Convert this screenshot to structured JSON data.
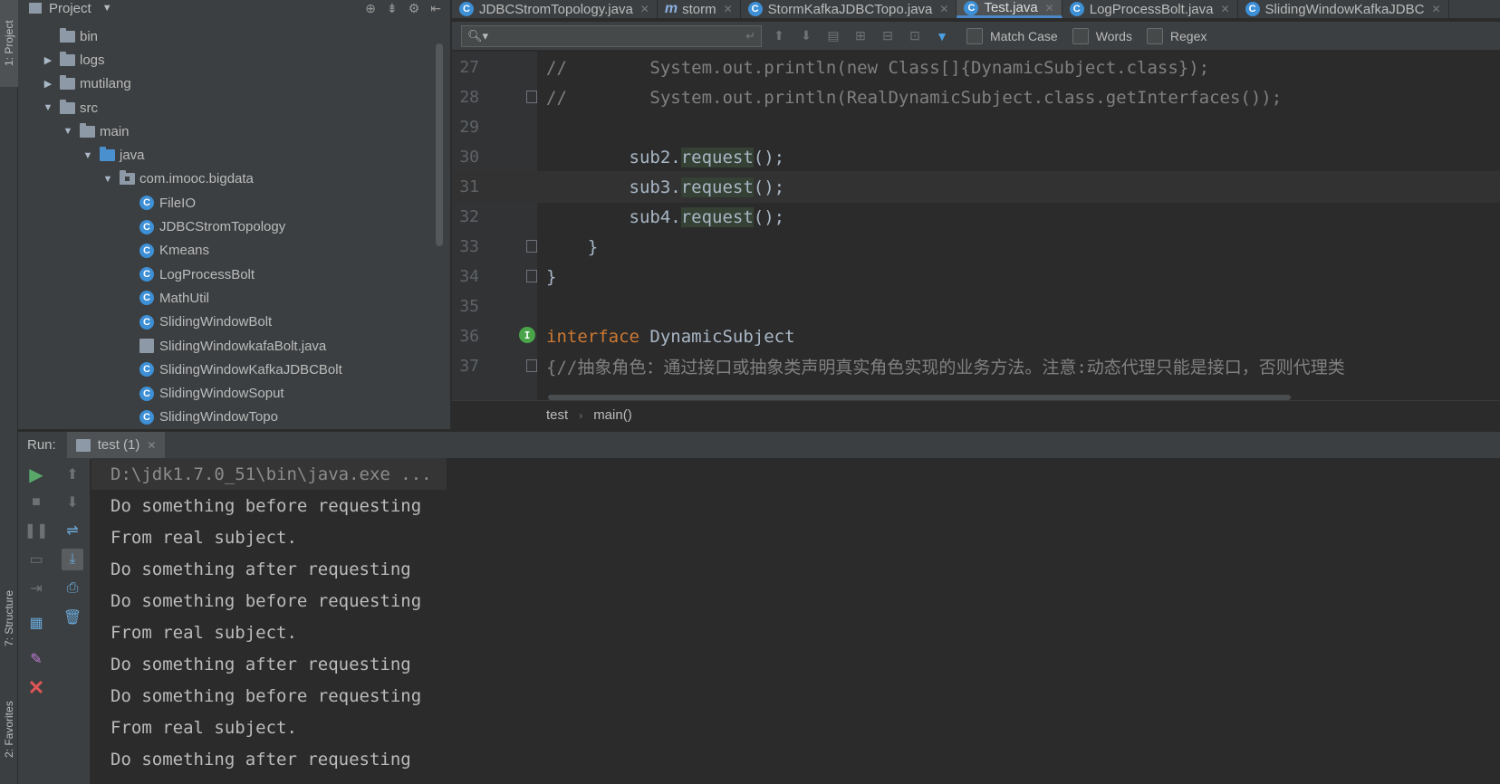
{
  "left_strip": {
    "project_tab": "1: Project",
    "structure_tab": "7: Structure",
    "favorites_tab": "2: Favorites"
  },
  "project_panel": {
    "title": "Project",
    "tree": [
      {
        "label": "bin",
        "type": "folder",
        "level": 1,
        "arrow": ""
      },
      {
        "label": "logs",
        "type": "folder",
        "level": 1,
        "arrow": "▶"
      },
      {
        "label": "mutilang",
        "type": "folder",
        "level": 1,
        "arrow": "▶"
      },
      {
        "label": "src",
        "type": "folder",
        "level": 1,
        "arrow": "▼"
      },
      {
        "label": "main",
        "type": "folder",
        "level": 2,
        "arrow": "▼"
      },
      {
        "label": "java",
        "type": "src-folder",
        "level": 3,
        "arrow": "▼"
      },
      {
        "label": "com.imooc.bigdata",
        "type": "package",
        "level": 4,
        "arrow": "▼"
      },
      {
        "label": "FileIO",
        "type": "class",
        "level": 5,
        "arrow": ""
      },
      {
        "label": "JDBCStromTopology",
        "type": "class",
        "level": 5,
        "arrow": ""
      },
      {
        "label": "Kmeans",
        "type": "class",
        "level": 5,
        "arrow": ""
      },
      {
        "label": "LogProcessBolt",
        "type": "class",
        "level": 5,
        "arrow": ""
      },
      {
        "label": "MathUtil",
        "type": "class",
        "level": 5,
        "arrow": ""
      },
      {
        "label": "SlidingWindowBolt",
        "type": "class",
        "level": 5,
        "arrow": ""
      },
      {
        "label": "SlidingWindowkafaBolt.java",
        "type": "file",
        "level": 5,
        "arrow": ""
      },
      {
        "label": "SlidingWindowKafkaJDBCBolt",
        "type": "class",
        "level": 5,
        "arrow": ""
      },
      {
        "label": "SlidingWindowSoput",
        "type": "class",
        "level": 5,
        "arrow": ""
      },
      {
        "label": "SlidingWindowTopo",
        "type": "class",
        "level": 5,
        "arrow": ""
      }
    ]
  },
  "editor_tabs": [
    {
      "label": "JDBCStromTopology.java",
      "icon": "class",
      "active": false
    },
    {
      "label": "storm",
      "icon": "m",
      "active": false
    },
    {
      "label": "StormKafkaJDBCTopo.java",
      "icon": "class",
      "active": false
    },
    {
      "label": "Test.java",
      "icon": "class",
      "active": true
    },
    {
      "label": "LogProcessBolt.java",
      "icon": "class",
      "active": false
    },
    {
      "label": "SlidingWindowKafkaJDBC",
      "icon": "class",
      "active": false
    }
  ],
  "search": {
    "placeholder": "",
    "match_case": "Match Case",
    "words": "Words",
    "regex": "Regex"
  },
  "code_lines": [
    {
      "num": "27",
      "text": "//        System.out.println(new Class[]{DynamicSubject.class});",
      "kind": "comment",
      "fold": false
    },
    {
      "num": "28",
      "text": "//        System.out.println(RealDynamicSubject.class.getInterfaces());",
      "kind": "comment",
      "fold": true
    },
    {
      "num": "29",
      "text": "",
      "kind": "plain",
      "fold": false
    },
    {
      "num": "30",
      "text_pre": "        sub2.",
      "method": "request",
      "text_post": "();",
      "kind": "call",
      "fold": false
    },
    {
      "num": "31",
      "text_pre": "        sub3.",
      "method": "request",
      "text_post": "();",
      "kind": "call",
      "fold": false,
      "current": true
    },
    {
      "num": "32",
      "text_pre": "        sub4.",
      "method": "request",
      "text_post": "();",
      "kind": "call",
      "fold": false
    },
    {
      "num": "33",
      "text": "    }",
      "kind": "plain",
      "fold": true
    },
    {
      "num": "34",
      "text": "}",
      "kind": "plain",
      "fold": true
    },
    {
      "num": "35",
      "text": "",
      "kind": "plain",
      "fold": false
    },
    {
      "num": "36",
      "text_kw": "interface",
      "text_post": " DynamicSubject",
      "kind": "decl",
      "fold": false,
      "impl": true
    },
    {
      "num": "37",
      "text": "{//抽象角色：通过接口或抽象类声明真实角色实现的业务方法。注意:动态代理只能是接口，否则代理类",
      "kind": "comment-brace",
      "fold": true
    }
  ],
  "breadcrumb": {
    "file": "test",
    "method": "main()"
  },
  "run": {
    "label": "Run:",
    "tab": "test (1)",
    "console": [
      "D:\\jdk1.7.0_51\\bin\\java.exe ...",
      "Do something before requesting",
      "From real subject.",
      "Do something after requesting",
      "Do something before requesting",
      "From real subject.",
      "Do something after requesting",
      "Do something before requesting",
      "From real subject.",
      "Do something after requesting"
    ]
  },
  "colors": {
    "accent": "#4a88c7",
    "keyword": "#cc7832",
    "comment": "#808080",
    "run_green": "#59a869",
    "stop_red": "#e05555"
  }
}
